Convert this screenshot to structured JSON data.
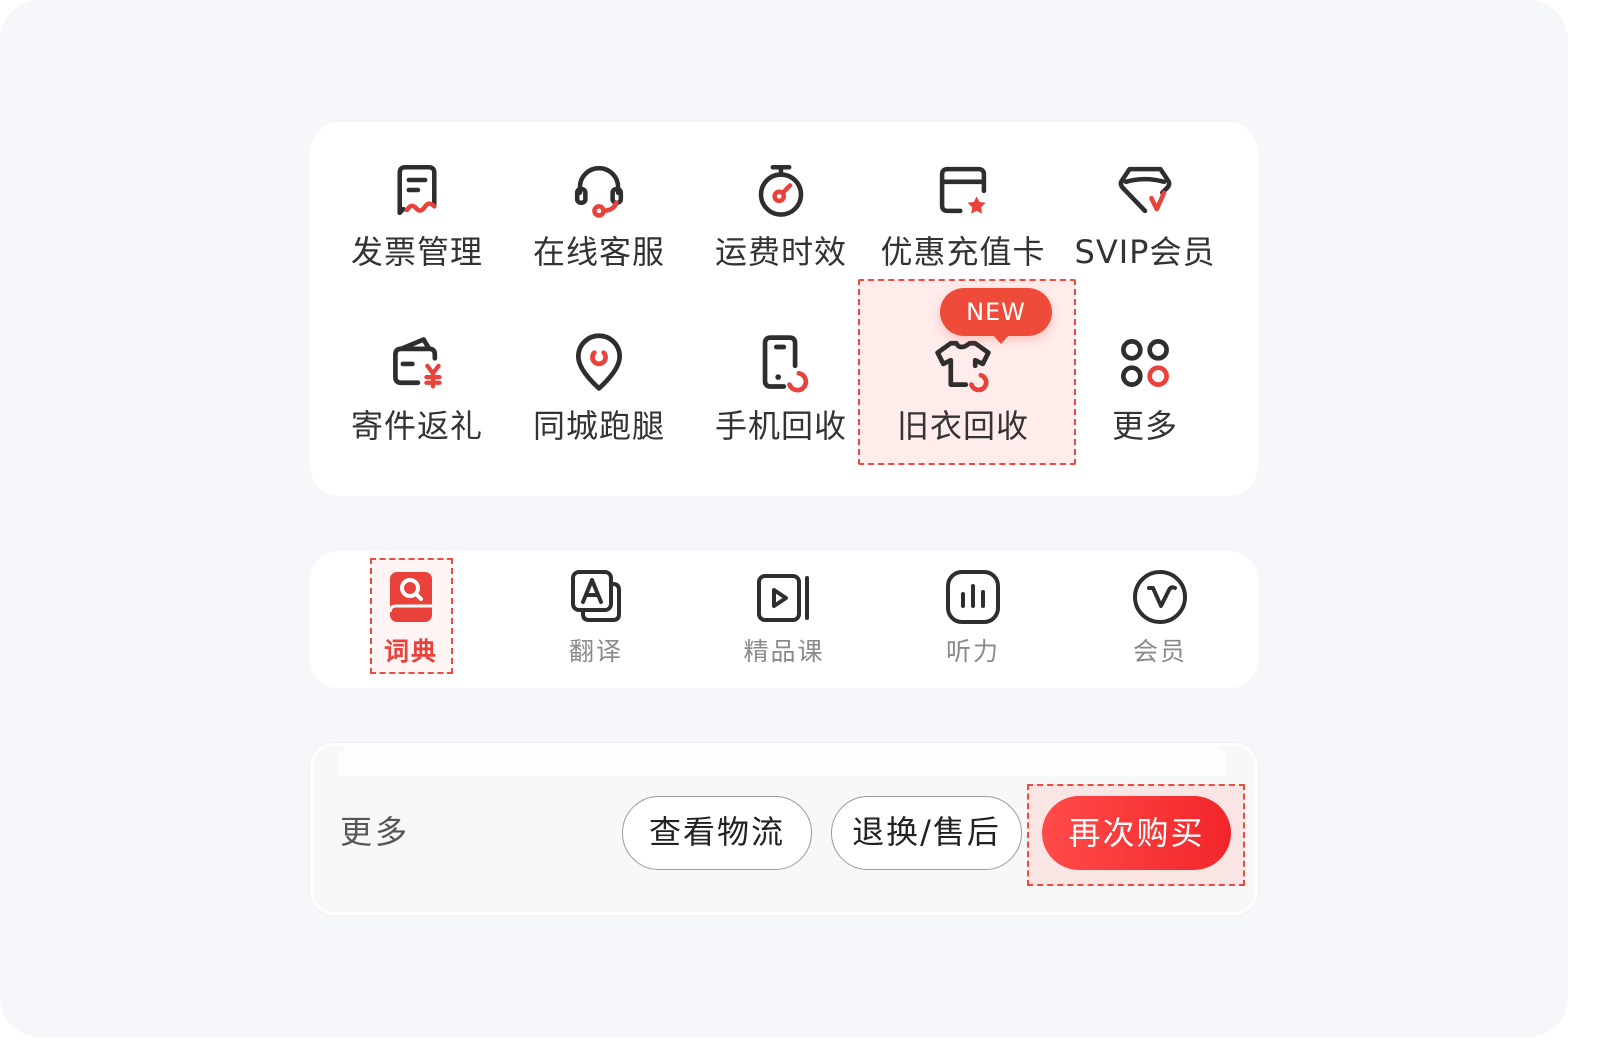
{
  "services": {
    "row1": [
      {
        "label": "发票管理",
        "icon": "invoice-icon"
      },
      {
        "label": "在线客服",
        "icon": "headset-icon"
      },
      {
        "label": "运费时效",
        "icon": "stopwatch-icon"
      },
      {
        "label": "优惠充值卡",
        "icon": "voucher-card-icon"
      },
      {
        "label": "SVIP会员",
        "icon": "svip-diamond-icon"
      }
    ],
    "row2": [
      {
        "label": "寄件返礼",
        "icon": "wallet-yen-icon"
      },
      {
        "label": "同城跑腿",
        "icon": "location-pin-icon"
      },
      {
        "label": "手机回收",
        "icon": "phone-recycle-icon"
      },
      {
        "label": "旧衣回收",
        "icon": "tshirt-recycle-icon"
      },
      {
        "label": "更多",
        "icon": "more-grid-icon"
      }
    ],
    "badge": "NEW"
  },
  "tabs": [
    {
      "label": "词典",
      "icon": "dictionary-icon",
      "active": true
    },
    {
      "label": "翻译",
      "icon": "translate-icon",
      "active": false
    },
    {
      "label": "精品课",
      "icon": "course-play-icon",
      "active": false
    },
    {
      "label": "听力",
      "icon": "listening-icon",
      "active": false
    },
    {
      "label": "会员",
      "icon": "member-v-icon",
      "active": false
    }
  ],
  "order_bar": {
    "more_label": "更多",
    "logistics_label": "查看物流",
    "refund_label": "退换/售后",
    "rebuy_label": "再次购买"
  },
  "colors": {
    "accent": "#ee4a40",
    "icon_stroke": "#2e2e2e",
    "background": "#f6f7fa"
  }
}
